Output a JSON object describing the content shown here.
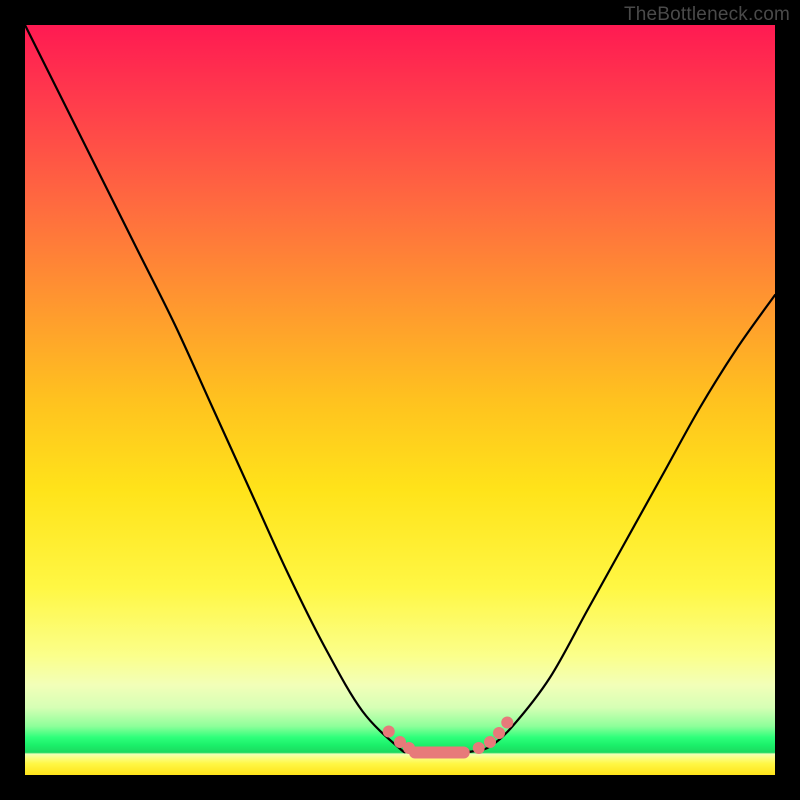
{
  "watermark": "TheBottleneck.com",
  "chart_data": {
    "type": "line",
    "title": "",
    "xlabel": "",
    "ylabel": "",
    "xlim": [
      0,
      100
    ],
    "ylim": [
      0,
      100
    ],
    "grid": false,
    "legend": false,
    "background_gradient": {
      "direction": "vertical",
      "stops": [
        {
          "pct": 0,
          "color": "#ff1a52"
        },
        {
          "pct": 25,
          "color": "#ff6e3e"
        },
        {
          "pct": 50,
          "color": "#ffc21f"
        },
        {
          "pct": 75,
          "color": "#fff744"
        },
        {
          "pct": 90,
          "color": "#f2ffb8"
        },
        {
          "pct": 95,
          "color": "#2eff7a"
        },
        {
          "pct": 100,
          "color": "#ffe31a"
        }
      ]
    },
    "series": [
      {
        "name": "bottleneck-curve",
        "stroke": "#000000",
        "x": [
          0,
          5,
          10,
          15,
          20,
          25,
          30,
          35,
          40,
          45,
          50,
          51,
          53,
          55,
          58,
          60,
          62,
          65,
          70,
          75,
          80,
          85,
          90,
          95,
          100
        ],
        "y": [
          100,
          90,
          80,
          70,
          60,
          49,
          38,
          27,
          17,
          8.5,
          3.5,
          3.2,
          3.0,
          3.0,
          3.0,
          3.2,
          3.8,
          6.5,
          13,
          22,
          31,
          40,
          49,
          57,
          64
        ]
      }
    ],
    "markers": [
      {
        "name": "highlight-beads-left",
        "color": "#e77a7a",
        "shape": "round",
        "points": [
          {
            "x": 48.5,
            "y": 5.8
          },
          {
            "x": 50.0,
            "y": 4.4
          },
          {
            "x": 51.2,
            "y": 3.6
          }
        ]
      },
      {
        "name": "highlight-strip-bottom",
        "color": "#e77a7a",
        "shape": "pill",
        "points": [
          {
            "x": 52.0,
            "y": 3.0
          },
          {
            "x": 58.5,
            "y": 3.0
          }
        ]
      },
      {
        "name": "highlight-beads-right",
        "color": "#e77a7a",
        "shape": "round",
        "points": [
          {
            "x": 60.5,
            "y": 3.6
          },
          {
            "x": 62.0,
            "y": 4.4
          },
          {
            "x": 63.2,
            "y": 5.6
          },
          {
            "x": 64.3,
            "y": 7.0
          }
        ]
      }
    ]
  }
}
